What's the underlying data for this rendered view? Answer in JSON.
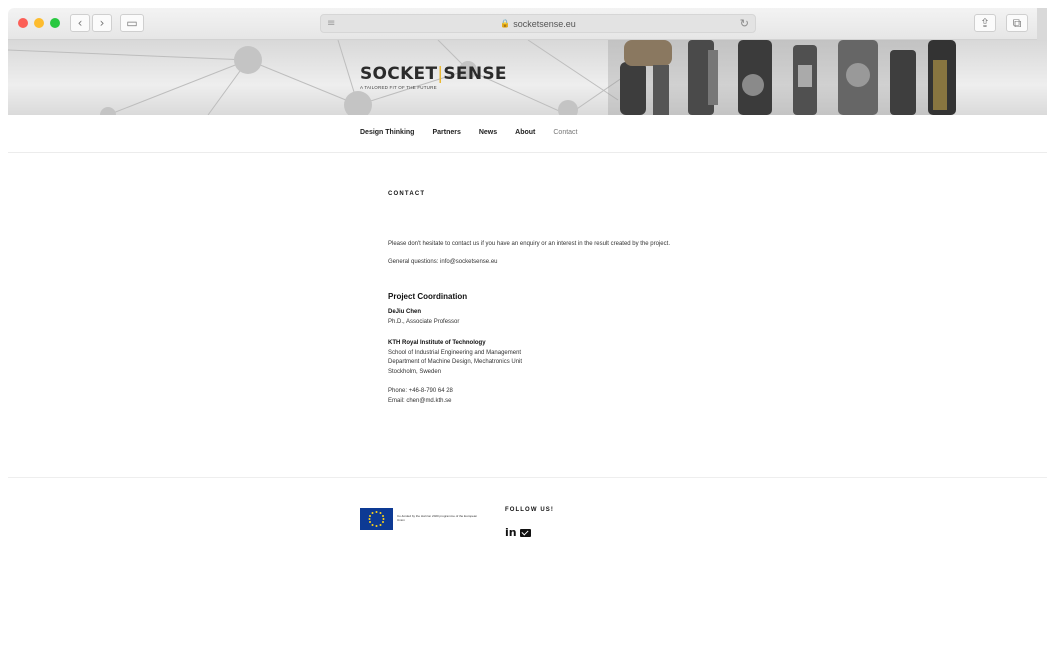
{
  "browser": {
    "url": "socketsense.eu",
    "back": "‹",
    "forward": "›",
    "sidebar": "▭",
    "reader": "≡",
    "reload": "↻",
    "lock": "🔒",
    "share": "⇪",
    "tabs": "⧉"
  },
  "site": {
    "logo_text_left": "SOCKET",
    "logo_text_sep": "|",
    "logo_text_right": "SENSE",
    "tagline": "A TAILORED FIT OF THE FUTURE"
  },
  "menu": [
    "Design Thinking",
    "Partners",
    "News",
    "About",
    "Contact"
  ],
  "content": {
    "heading": "CONTACT",
    "intro": "Please don't hesitate to contact us if you have an enquiry or an interest in the result created by the project.",
    "general": "General questions: info@socketsense.eu",
    "coordination_title": "Project Coordination",
    "person_name": "DeJiu Chen",
    "person_title": "Ph.D., Associate Professor",
    "institute": "KTH Royal Institute of Technology",
    "school": "School of Industrial Engineering and Management",
    "department": "Department of Machine Design, Mechatronics Unit",
    "city": "Stockholm, Sweden",
    "phone": "Phone: +46-8-790 64 28",
    "email": "Email: chen@md.kth.se"
  },
  "footer": {
    "eu_text": "Co-funded by the Horizon 2020 programme of the European Union",
    "follow_title": "FOLLOW US!",
    "linkedin": "in"
  }
}
